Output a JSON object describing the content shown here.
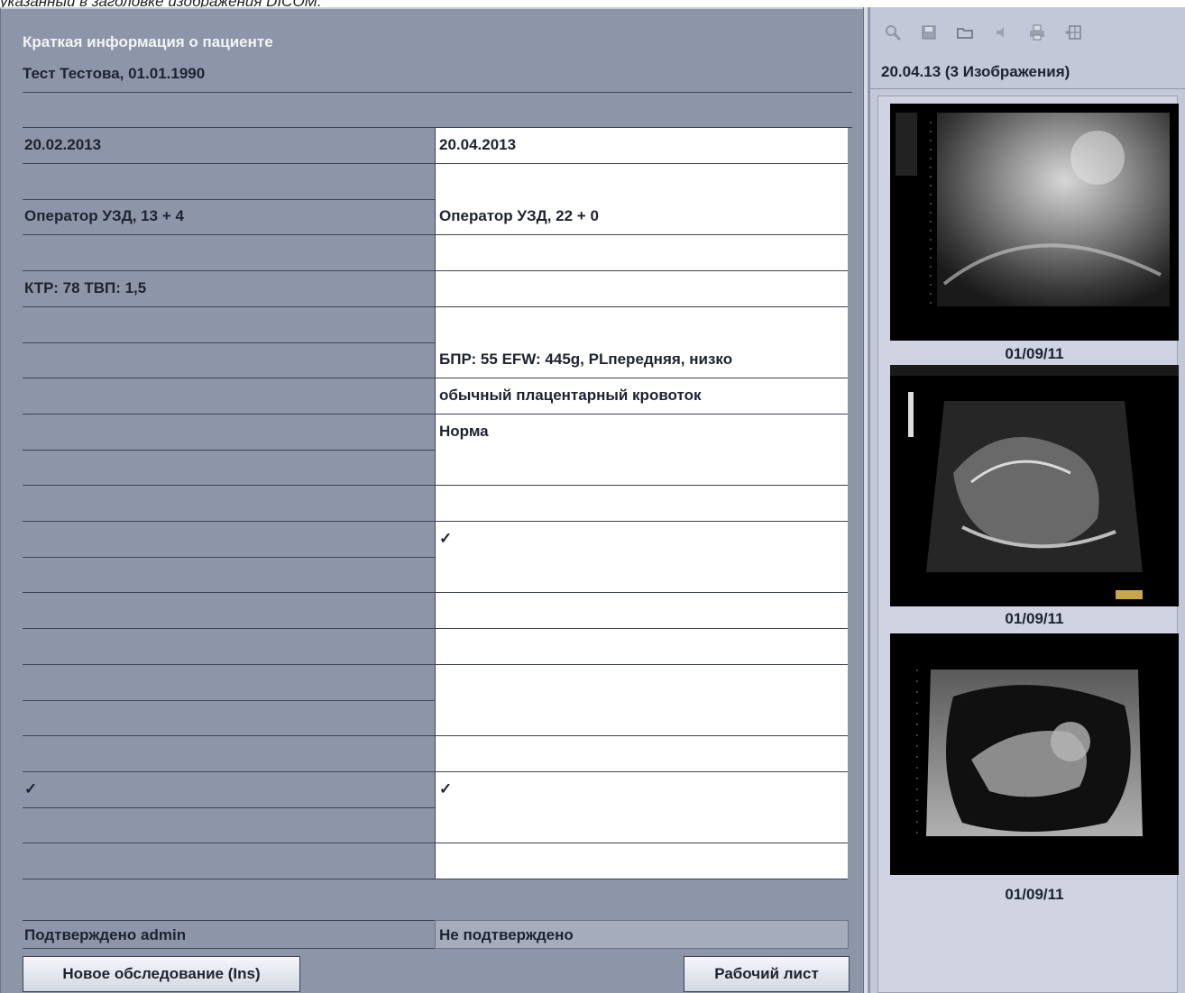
{
  "caption": "указанный в заголовке изображения DICOM.",
  "header": {
    "title": "Краткая информация о пациенте",
    "patient": "Тест Тестова, 01.01.1990"
  },
  "table": {
    "rows": [
      {
        "left": "20.02.2013",
        "right": "20.04.2013"
      },
      {
        "left": "",
        "right": ""
      },
      {
        "left": "Оператор УЗД, 13 + 4",
        "right": "Оператор УЗД, 22 + 0"
      },
      {
        "left": "",
        "right": ""
      },
      {
        "left": "КТР: 78 ТВП: 1,5",
        "right": ""
      },
      {
        "left": "",
        "right": ""
      },
      {
        "left": "",
        "right": "БПР: 55 EFW: 445g, PLпередняя, низко"
      },
      {
        "left": "",
        "right": "обычный плацентарный кровоток"
      },
      {
        "left": "",
        "right": "Норма"
      },
      {
        "left": "",
        "right": ""
      },
      {
        "left": "",
        "right": ""
      },
      {
        "left": "",
        "right": "✓"
      },
      {
        "left": "",
        "right": ""
      },
      {
        "left": "",
        "right": ""
      },
      {
        "left": "",
        "right": ""
      },
      {
        "left": "",
        "right": ""
      },
      {
        "left": "",
        "right": ""
      },
      {
        "left": "",
        "right": ""
      },
      {
        "left": "✓",
        "right": "✓"
      },
      {
        "left": "",
        "right": ""
      },
      {
        "left": "",
        "right": ""
      }
    ]
  },
  "status": {
    "left": "Подтверждено admin",
    "right": "Не подтверждено"
  },
  "buttons": {
    "new_exam": "Новое обследование (Ins)",
    "worksheet": "Рабочий лист"
  },
  "viewer": {
    "toolbar_icons": [
      "zoom-icon",
      "save-icon",
      "folder-icon",
      "volume-icon",
      "print-icon",
      "layout-icon"
    ],
    "study_title": "20.04.13  (3 Изображения)",
    "thumbnails": [
      {
        "label": "01/09/11"
      },
      {
        "label": "01/09/11"
      },
      {
        "label": "01/09/11"
      }
    ]
  },
  "colors": {
    "panel_bg": "#8d96a8",
    "viewer_bg": "#c3c8d9",
    "checkmark": "#14206e"
  }
}
